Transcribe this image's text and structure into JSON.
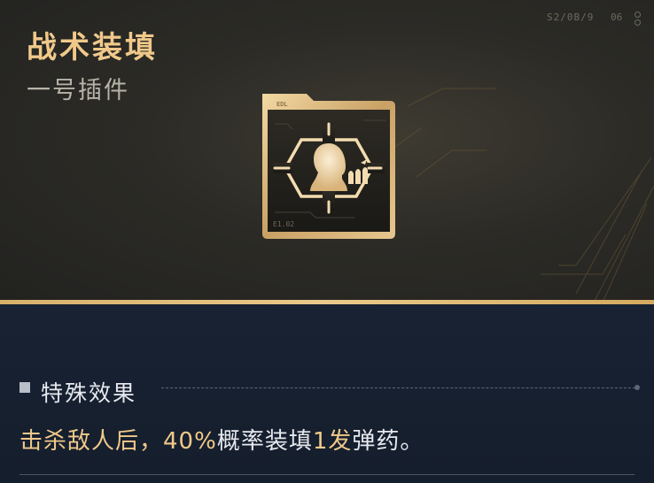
{
  "header": {
    "title": "战术装填",
    "subtitle": "一号插件",
    "corner_code": "S2/0B/9",
    "corner_num": "06"
  },
  "plugin_icon": {
    "icon": "tactical-reload-plugin-icon",
    "label_top": "EDL",
    "label_bottom": "E1.02"
  },
  "effect_section": {
    "title": "特殊效果",
    "parts": [
      {
        "text": "击杀敌人后，",
        "style": "gold"
      },
      {
        "text": "40%",
        "style": "gold"
      },
      {
        "text": "概率装填",
        "style": "white"
      },
      {
        "text": "1发",
        "style": "gold"
      },
      {
        "text": "弹药。",
        "style": "white"
      }
    ]
  },
  "colors": {
    "accent_gold": "#f0c98a",
    "text_light": "#e7e9ee",
    "top_bg": "#2c2b26",
    "bottom_bg": "#182233"
  }
}
